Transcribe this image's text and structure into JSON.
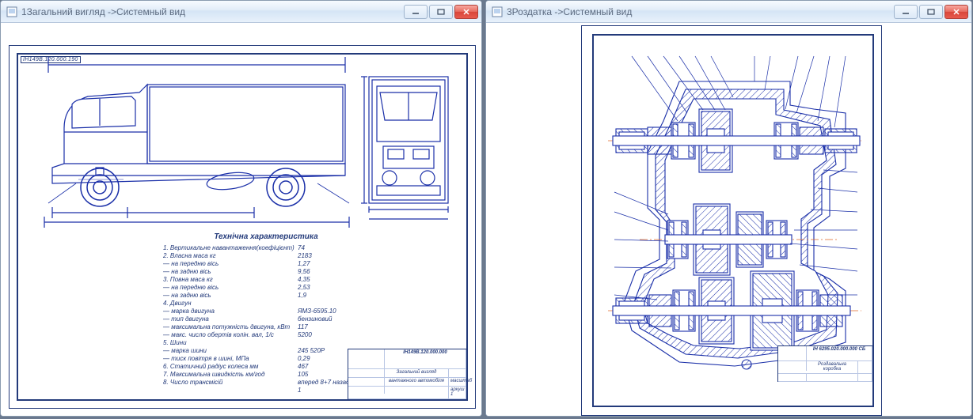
{
  "windows": {
    "left": {
      "title": "1Загальний вигляд ->Системный вид",
      "minimize_tip": "Minimize",
      "maximize_tip": "Maximize",
      "close_tip": "Close",
      "stamp": "ІН149В.120.000.190",
      "tech_spec_header": "Технічна характеристика",
      "spec": [
        {
          "k": "1. Вертикальне навантаження(коефіцієнт)",
          "v": "74"
        },
        {
          "k": "2. Власна маса кг",
          "v": "2183"
        },
        {
          "k": "   — на передню вісь",
          "v": "1,27"
        },
        {
          "k": "   — на задню вісь",
          "v": "9,56"
        },
        {
          "k": "3. Повна маса кг",
          "v": "4,35"
        },
        {
          "k": "   — на передню вісь",
          "v": "2,53"
        },
        {
          "k": "   — на задню вісь",
          "v": "1,9"
        },
        {
          "k": "4. Двигун",
          "v": ""
        },
        {
          "k": "   — марка двигуна",
          "v": "ЯМЗ-6595.10"
        },
        {
          "k": "   — тип двигуна",
          "v": "бензиновий"
        },
        {
          "k": "   — максимальна потужність двигуна, кВт",
          "v": "117"
        },
        {
          "k": "   — макс. число обертів колін. вал, 1/с",
          "v": "5200"
        },
        {
          "k": "5. Шини",
          "v": ""
        },
        {
          "k": "   — марка шини",
          "v": "245 520Р"
        },
        {
          "k": "   — тиск повітря в шині, МПа",
          "v": "0,29"
        },
        {
          "k": "6. Статичний радіус колеса мм",
          "v": "467"
        },
        {
          "k": "7. Максимальна швидкість км/год",
          "v": "105"
        },
        {
          "k": "8. Число трансмісій",
          "v": "вперед 8+7 назад 1"
        }
      ],
      "title_block": {
        "code": "ІН149В.120.000.000",
        "name1": "Загальний вигляд",
        "name2": "вантажного автомобіля",
        "scale": "масштаб",
        "sheet": "аркуш 1"
      }
    },
    "right": {
      "title": "3Роздатка ->Системный вид",
      "title_block": {
        "code": "ІН 6295.020.000.000 СБ",
        "name": "Роздавальна коробка"
      }
    }
  }
}
